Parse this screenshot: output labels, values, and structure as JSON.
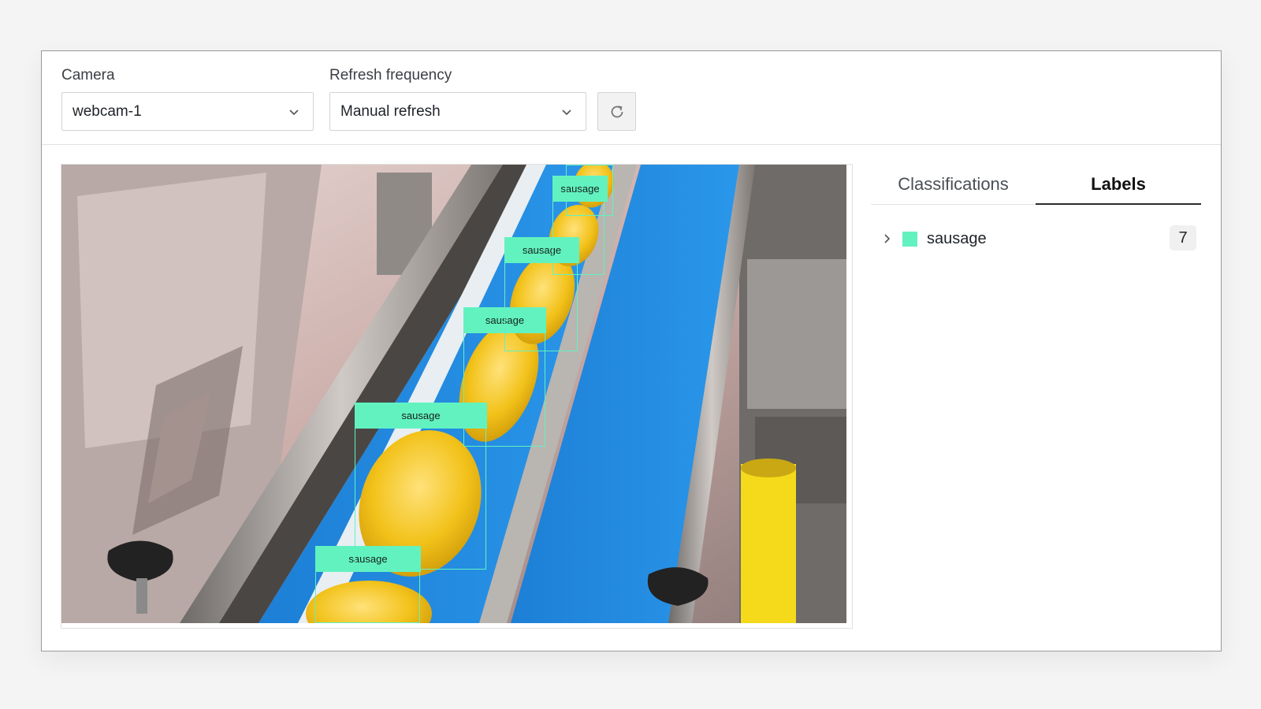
{
  "toolbar": {
    "camera": {
      "label": "Camera",
      "value": "webcam-1"
    },
    "refresh_frequency": {
      "label": "Refresh frequency",
      "value": "Manual refresh"
    },
    "refresh_icon": "refresh-icon"
  },
  "detections": [
    {
      "label": "sausage"
    },
    {
      "label": "sausage"
    },
    {
      "label": "sausage"
    },
    {
      "label": "sausage"
    },
    {
      "label": "sausage"
    }
  ],
  "sidebar": {
    "tabs": [
      {
        "label": "Classifications",
        "active": false
      },
      {
        "label": "Labels",
        "active": true
      }
    ],
    "labels": [
      {
        "name": "sausage",
        "count": "7",
        "color": "#62f2c0"
      }
    ]
  },
  "colors": {
    "accent": "#62f2c0",
    "conveyor_blue": "#1f8fe0"
  }
}
